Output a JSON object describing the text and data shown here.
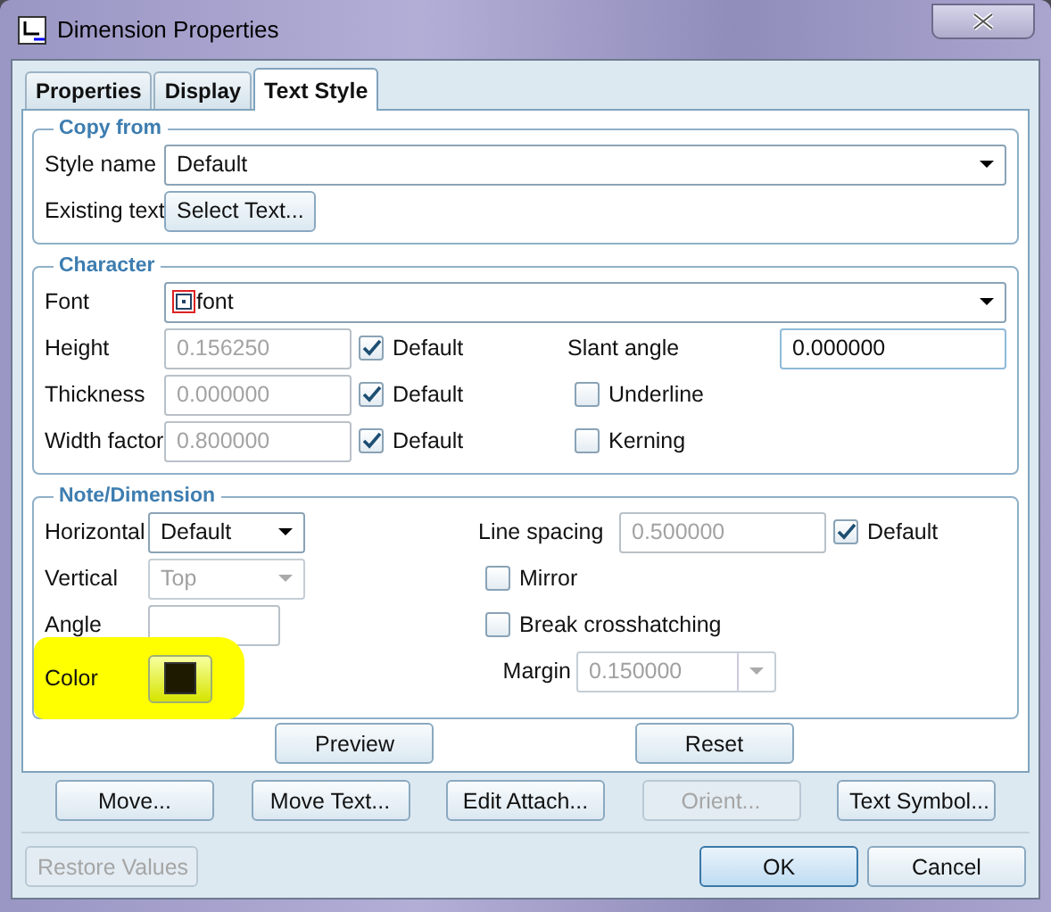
{
  "window": {
    "title": "Dimension Properties"
  },
  "tabs": [
    {
      "label": "Properties",
      "selected": false
    },
    {
      "label": "Display",
      "selected": false
    },
    {
      "label": "Text Style",
      "selected": true
    }
  ],
  "copy_from": {
    "title": "Copy from",
    "style_name": {
      "label": "Style name",
      "value": "Default"
    },
    "existing_text": {
      "label": "Existing text",
      "button": "Select Text..."
    }
  },
  "character": {
    "title": "Character",
    "font": {
      "label": "Font",
      "value": "font"
    },
    "fields": [
      {
        "label": "Height",
        "value": "0.156250",
        "disabled": true,
        "default_label": "Default",
        "default_checked": true
      },
      {
        "label": "Thickness",
        "value": "0.000000",
        "disabled": true,
        "default_label": "Default",
        "default_checked": true
      },
      {
        "label": "Width factor",
        "value": "0.800000",
        "disabled": true,
        "default_label": "Default",
        "default_checked": true
      }
    ],
    "options": [
      {
        "kind": "field",
        "label": "Slant angle",
        "value": "0.000000"
      },
      {
        "kind": "checkbox",
        "label": "Underline",
        "checked": false
      },
      {
        "kind": "checkbox",
        "label": "Kerning",
        "checked": false
      }
    ]
  },
  "note": {
    "title": "Note/Dimension",
    "left": [
      {
        "kind": "dropdown",
        "label": "Horizontal",
        "value": "Default",
        "disabled": false
      },
      {
        "kind": "dropdown",
        "label": "Vertical",
        "value": "Top",
        "disabled": true
      },
      {
        "kind": "field",
        "label": "Angle"
      },
      {
        "kind": "color",
        "label": "Color",
        "color": "#1e1a00",
        "highlighted": true
      }
    ],
    "right": [
      {
        "kind": "field",
        "label": "Line spacing",
        "value": "0.500000",
        "disabled": true,
        "default_label": "Default",
        "default_checked": true
      },
      {
        "kind": "checkbox",
        "label": "Mirror",
        "checked": false
      },
      {
        "kind": "checkbox",
        "label": "Break crosshatching",
        "checked": false
      },
      {
        "kind": "spin",
        "label": "Margin",
        "value": "0.150000",
        "disabled": true
      }
    ]
  },
  "panel_buttons": [
    {
      "label": "Preview",
      "disabled": false
    },
    {
      "label": "Reset",
      "disabled": false
    }
  ],
  "action_buttons": [
    {
      "label": "Move...",
      "disabled": false
    },
    {
      "label": "Move Text...",
      "disabled": false
    },
    {
      "label": "Edit Attach...",
      "disabled": false
    },
    {
      "label": "Orient...",
      "disabled": true
    },
    {
      "label": "Text Symbol...",
      "disabled": false
    }
  ],
  "footer": {
    "restore": {
      "label": "Restore Values",
      "disabled": true
    },
    "ok": {
      "label": "OK",
      "default": true
    },
    "cancel": {
      "label": "Cancel"
    }
  }
}
